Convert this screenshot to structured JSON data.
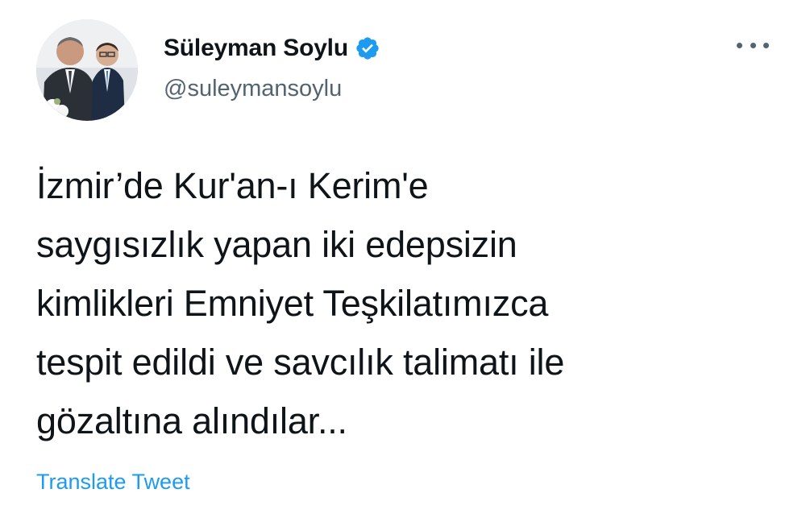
{
  "tweet": {
    "author": {
      "display_name": "Süleyman Soylu",
      "handle": "@suleymansoylu",
      "verified": true,
      "verified_icon": "verified-badge-icon",
      "avatar_icon": "profile-photo"
    },
    "menu_icon": "more-options-icon",
    "text": "İzmir’de Kur'an-ı Kerim'e\nsaygısızlık yapan iki edepsizin\nkimlikleri Emniyet Teşkilatımızca\ntespit edildi ve savcılık talimatı ile\ngözaltına alındılar...",
    "translate_label": "Translate Tweet"
  },
  "colors": {
    "text": "#0f1419",
    "secondary_text": "#536471",
    "accent": "#1d9bf0",
    "background": "#ffffff"
  }
}
